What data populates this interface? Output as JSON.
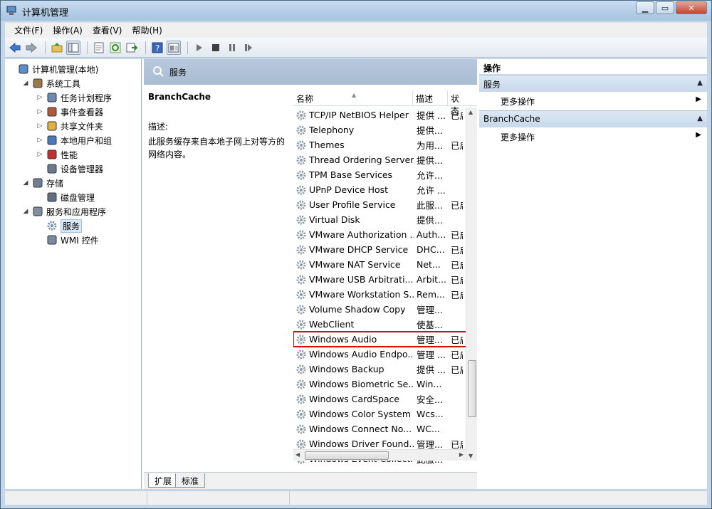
{
  "window": {
    "title": "计算机管理"
  },
  "menu": [
    "文件(F)",
    "操作(A)",
    "查看(V)",
    "帮助(H)"
  ],
  "toolbar": {
    "icons": [
      "back-icon",
      "forward-icon",
      "up-folder-icon",
      "show-tree-icon",
      "properties-icon",
      "refresh-icon",
      "export-icon",
      "help-icon",
      "console-icon",
      "play-icon",
      "stop-icon",
      "pause-icon",
      "restart-icon"
    ]
  },
  "tree": {
    "items": [
      {
        "label": "计算机管理(本地)",
        "icon": "computer-icon",
        "level": 0,
        "twisty": ""
      },
      {
        "label": "系统工具",
        "icon": "tools-icon",
        "level": 1,
        "twisty": "◢"
      },
      {
        "label": "任务计划程序",
        "icon": "clock-icon",
        "level": 2,
        "twisty": "▷"
      },
      {
        "label": "事件查看器",
        "icon": "event-viewer-icon",
        "level": 2,
        "twisty": "▷"
      },
      {
        "label": "共享文件夹",
        "icon": "shared-folder-icon",
        "level": 2,
        "twisty": "▷"
      },
      {
        "label": "本地用户和组",
        "icon": "users-icon",
        "level": 2,
        "twisty": "▷"
      },
      {
        "label": "性能",
        "icon": "performance-icon",
        "level": 2,
        "twisty": "▷"
      },
      {
        "label": "设备管理器",
        "icon": "device-manager-icon",
        "level": 2,
        "twisty": ""
      },
      {
        "label": "存储",
        "icon": "storage-icon",
        "level": 1,
        "twisty": "◢"
      },
      {
        "label": "磁盘管理",
        "icon": "disk-icon",
        "level": 2,
        "twisty": ""
      },
      {
        "label": "服务和应用程序",
        "icon": "services-apps-icon",
        "level": 1,
        "twisty": "◢"
      },
      {
        "label": "服务",
        "icon": "gear-icon",
        "level": 2,
        "twisty": "",
        "selected": true
      },
      {
        "label": "WMI 控件",
        "icon": "wmi-icon",
        "level": 2,
        "twisty": ""
      }
    ]
  },
  "services": {
    "header": "服务",
    "selected_name": "BranchCache",
    "desc_label": "描述:",
    "desc_text": "此服务缓存来自本地子网上对等方的网络内容。",
    "columns": [
      "名称",
      "描述",
      "状态"
    ],
    "rows": [
      {
        "name": "TCP/IP NetBIOS Helper",
        "desc": "提供 ...",
        "status": "已启"
      },
      {
        "name": "Telephony",
        "desc": "提供...",
        "status": ""
      },
      {
        "name": "Themes",
        "desc": "为用...",
        "status": "已启"
      },
      {
        "name": "Thread Ordering Server",
        "desc": "提供...",
        "status": ""
      },
      {
        "name": "TPM Base Services",
        "desc": "允许...",
        "status": ""
      },
      {
        "name": "UPnP Device Host",
        "desc": "允许 ...",
        "status": ""
      },
      {
        "name": "User Profile Service",
        "desc": "此服...",
        "status": "已启"
      },
      {
        "name": "Virtual Disk",
        "desc": "提供...",
        "status": ""
      },
      {
        "name": "VMware Authorization ...",
        "desc": "Auth...",
        "status": "已启"
      },
      {
        "name": "VMware DHCP Service",
        "desc": "DHC...",
        "status": "已启"
      },
      {
        "name": "VMware NAT Service",
        "desc": "Net...",
        "status": "已启"
      },
      {
        "name": "VMware USB Arbitrati...",
        "desc": "Arbit...",
        "status": "已启"
      },
      {
        "name": "VMware Workstation S...",
        "desc": "Rem...",
        "status": "已启"
      },
      {
        "name": "Volume Shadow Copy",
        "desc": "管理...",
        "status": ""
      },
      {
        "name": "WebClient",
        "desc": "使基...",
        "status": ""
      },
      {
        "name": "Windows Audio",
        "desc": "管理...",
        "status": "已启",
        "highlight": true
      },
      {
        "name": "Windows Audio Endpo...",
        "desc": "管理 ...",
        "status": "已启"
      },
      {
        "name": "Windows Backup",
        "desc": "提供 ...",
        "status": "已启"
      },
      {
        "name": "Windows Biometric Se...",
        "desc": "Win...",
        "status": ""
      },
      {
        "name": "Windows CardSpace",
        "desc": "安全...",
        "status": ""
      },
      {
        "name": "Windows Color System",
        "desc": "Wcs...",
        "status": ""
      },
      {
        "name": "Windows Connect No...",
        "desc": "WC...",
        "status": ""
      },
      {
        "name": "Windows Driver Found...",
        "desc": "管理...",
        "status": "已启"
      },
      {
        "name": "Windows Event Collect...",
        "desc": "此服...",
        "status": ""
      }
    ],
    "tabs": [
      "扩展",
      "标准"
    ]
  },
  "actions": {
    "title": "操作",
    "sections": [
      {
        "label": "服务",
        "item": "更多操作"
      },
      {
        "label": "BranchCache",
        "item": "更多操作"
      }
    ]
  }
}
